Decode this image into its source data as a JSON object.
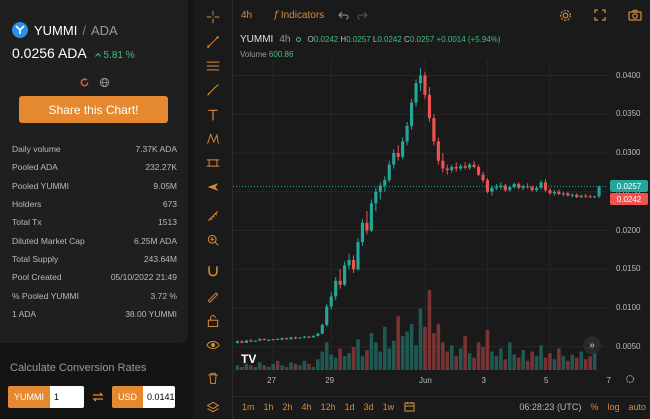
{
  "token": {
    "symbol": "YUMMI",
    "separator": "/",
    "quote": "ADA",
    "price": "0.0256 ADA",
    "change": "5.81 %",
    "change_arrow": "^"
  },
  "share_button_label": "Share this Chart!",
  "stats": [
    {
      "label": "Daily volume",
      "value": "7.37K ADA"
    },
    {
      "label": "Pooled ADA",
      "value": "232.27K"
    },
    {
      "label": "Pooled YUMMI",
      "value": "9.05M"
    },
    {
      "label": "Holders",
      "value": "673"
    },
    {
      "label": "Total Tx",
      "value": "1513"
    },
    {
      "label": "Diluted Market Cap",
      "value": "6.25M ADA"
    },
    {
      "label": "Total Supply",
      "value": "243.64M"
    },
    {
      "label": "Pool Created",
      "value": "05/10/2022 21:49"
    },
    {
      "label": "% Pooled YUMMI",
      "value": "3.72 %"
    },
    {
      "label": "1 ADA",
      "value": "38.00 YUMMI"
    }
  ],
  "conversion": {
    "title": "Calculate Conversion Rates",
    "from_label": "YUMMI",
    "from_value": "1",
    "to_label": "USD",
    "to_value": "0.0141"
  },
  "chart_toolbar": {
    "interval": "4h",
    "indicators_label": "Indicators"
  },
  "chart_legend": {
    "symbol": "YUMMI",
    "interval": "4h",
    "o_label": "O",
    "o": "0.0242",
    "h_label": "H",
    "h": "0.0257",
    "l_label": "L",
    "l": "0.0242",
    "c_label": "C",
    "c": "0.0257",
    "change": "+0.0014 (+5.94%)",
    "volume_label": "Volume",
    "volume": "600.86"
  },
  "bottom_bar": {
    "timeframes": [
      "1m",
      "1h",
      "2h",
      "4h",
      "12h",
      "1d",
      "3d",
      "1w"
    ],
    "clock": "06:28:23 (UTC)",
    "percent": "%",
    "log": "log",
    "auto": "auto"
  },
  "tv_logo": "TV",
  "colors": {
    "up": "#26a69a",
    "down": "#ef5350",
    "accent": "#e4892f"
  },
  "chart_data": {
    "type": "candlestick",
    "ylim": [
      0.002,
      0.042
    ],
    "yticks": [
      "0.0400",
      "0.0350",
      "0.0300",
      "0.0250",
      "0.0200",
      "0.0150",
      "0.0100",
      "0.0050"
    ],
    "ytick_values": [
      0.04,
      0.035,
      0.03,
      0.025,
      0.02,
      0.015,
      0.01,
      0.005
    ],
    "xticks": [
      "27",
      "29",
      "Jun",
      "3",
      "5",
      "7"
    ],
    "xtick_index": [
      8,
      21,
      42,
      56,
      70,
      84
    ],
    "last_price_tag": "0.0257",
    "low_price_tag": "0.0242",
    "last_price": 0.0257,
    "low_price": 0.0242,
    "candles": [
      [
        0.0055,
        0.0058,
        0.0054,
        0.0057
      ],
      [
        0.0057,
        0.0058,
        0.0055,
        0.0055
      ],
      [
        0.0055,
        0.0059,
        0.0055,
        0.0058
      ],
      [
        0.0058,
        0.006,
        0.0056,
        0.0057
      ],
      [
        0.0057,
        0.0058,
        0.0056,
        0.0058
      ],
      [
        0.0058,
        0.0061,
        0.0057,
        0.006
      ],
      [
        0.006,
        0.0061,
        0.0058,
        0.0059
      ],
      [
        0.0059,
        0.006,
        0.0057,
        0.0059
      ],
      [
        0.0059,
        0.006,
        0.0058,
        0.006
      ],
      [
        0.006,
        0.0061,
        0.0059,
        0.0059
      ],
      [
        0.0059,
        0.0062,
        0.0059,
        0.0061
      ],
      [
        0.0061,
        0.0062,
        0.0059,
        0.006
      ],
      [
        0.006,
        0.0063,
        0.0059,
        0.0062
      ],
      [
        0.0062,
        0.0063,
        0.006,
        0.0061
      ],
      [
        0.0061,
        0.0062,
        0.006,
        0.0062
      ],
      [
        0.0062,
        0.0064,
        0.0061,
        0.0063
      ],
      [
        0.0063,
        0.0064,
        0.0061,
        0.0062
      ],
      [
        0.0062,
        0.0065,
        0.0062,
        0.0064
      ],
      [
        0.0064,
        0.0068,
        0.0063,
        0.0067
      ],
      [
        0.0067,
        0.008,
        0.0066,
        0.0078
      ],
      [
        0.0078,
        0.0105,
        0.0076,
        0.0102
      ],
      [
        0.0102,
        0.012,
        0.0098,
        0.0115
      ],
      [
        0.0115,
        0.014,
        0.011,
        0.0135
      ],
      [
        0.0135,
        0.015,
        0.0125,
        0.013
      ],
      [
        0.013,
        0.016,
        0.0128,
        0.0155
      ],
      [
        0.0155,
        0.017,
        0.015,
        0.0162
      ],
      [
        0.0162,
        0.0168,
        0.0145,
        0.015
      ],
      [
        0.015,
        0.019,
        0.0148,
        0.0185
      ],
      [
        0.0185,
        0.0215,
        0.018,
        0.021
      ],
      [
        0.021,
        0.0225,
        0.0195,
        0.02
      ],
      [
        0.02,
        0.024,
        0.0198,
        0.0235
      ],
      [
        0.0235,
        0.0255,
        0.0225,
        0.025
      ],
      [
        0.025,
        0.0262,
        0.024,
        0.0258
      ],
      [
        0.0258,
        0.027,
        0.025,
        0.0265
      ],
      [
        0.0265,
        0.029,
        0.0262,
        0.0285
      ],
      [
        0.0285,
        0.0305,
        0.028,
        0.03
      ],
      [
        0.03,
        0.031,
        0.029,
        0.0295
      ],
      [
        0.0295,
        0.032,
        0.0292,
        0.0315
      ],
      [
        0.0315,
        0.034,
        0.031,
        0.0335
      ],
      [
        0.0335,
        0.037,
        0.033,
        0.0365
      ],
      [
        0.0365,
        0.0395,
        0.036,
        0.039
      ],
      [
        0.039,
        0.041,
        0.038,
        0.04
      ],
      [
        0.04,
        0.0405,
        0.037,
        0.0375
      ],
      [
        0.0375,
        0.0385,
        0.034,
        0.0345
      ],
      [
        0.0345,
        0.035,
        0.031,
        0.0315
      ],
      [
        0.0315,
        0.032,
        0.0285,
        0.029
      ],
      [
        0.029,
        0.03,
        0.0275,
        0.028
      ],
      [
        0.028,
        0.0285,
        0.0272,
        0.0278
      ],
      [
        0.0278,
        0.0285,
        0.0275,
        0.0282
      ],
      [
        0.0282,
        0.0288,
        0.0276,
        0.028
      ],
      [
        0.028,
        0.0286,
        0.0277,
        0.0283
      ],
      [
        0.0283,
        0.0288,
        0.0279,
        0.0281
      ],
      [
        0.0281,
        0.0287,
        0.0278,
        0.0285
      ],
      [
        0.0285,
        0.029,
        0.028,
        0.0282
      ],
      [
        0.0282,
        0.0285,
        0.027,
        0.0272
      ],
      [
        0.0272,
        0.0276,
        0.0262,
        0.0265
      ],
      [
        0.0265,
        0.0268,
        0.0248,
        0.025
      ],
      [
        0.025,
        0.0258,
        0.0245,
        0.0255
      ],
      [
        0.0255,
        0.026,
        0.0252,
        0.0256
      ],
      [
        0.0256,
        0.0262,
        0.0253,
        0.0258
      ],
      [
        0.0258,
        0.026,
        0.025,
        0.0252
      ],
      [
        0.0252,
        0.0258,
        0.025,
        0.0256
      ],
      [
        0.0256,
        0.0262,
        0.0254,
        0.026
      ],
      [
        0.026,
        0.0262,
        0.0253,
        0.0255
      ],
      [
        0.0255,
        0.0259,
        0.0252,
        0.0257
      ],
      [
        0.0257,
        0.0261,
        0.0254,
        0.0256
      ],
      [
        0.0256,
        0.0258,
        0.025,
        0.0252
      ],
      [
        0.0252,
        0.0257,
        0.025,
        0.0255
      ],
      [
        0.0255,
        0.0265,
        0.0253,
        0.0262
      ],
      [
        0.0262,
        0.0266,
        0.025,
        0.0252
      ],
      [
        0.0252,
        0.0255,
        0.0246,
        0.0248
      ],
      [
        0.0248,
        0.0252,
        0.0245,
        0.025
      ],
      [
        0.025,
        0.0253,
        0.0246,
        0.0247
      ],
      [
        0.0247,
        0.025,
        0.0244,
        0.0248
      ],
      [
        0.0248,
        0.025,
        0.0244,
        0.0245
      ],
      [
        0.0245,
        0.0248,
        0.0243,
        0.0246
      ],
      [
        0.0246,
        0.0248,
        0.0242,
        0.0243
      ],
      [
        0.0243,
        0.0246,
        0.0242,
        0.0245
      ],
      [
        0.0245,
        0.0247,
        0.0242,
        0.0244
      ],
      [
        0.0244,
        0.0246,
        0.0242,
        0.0243
      ],
      [
        0.0243,
        0.0245,
        0.0242,
        0.0244
      ],
      [
        0.0244,
        0.0257,
        0.0242,
        0.0257
      ]
    ],
    "volumes": [
      3,
      2,
      4,
      3,
      2,
      5,
      3,
      2,
      4,
      6,
      3,
      2,
      5,
      4,
      3,
      6,
      4,
      2,
      7,
      12,
      18,
      10,
      8,
      14,
      9,
      11,
      15,
      20,
      9,
      13,
      24,
      18,
      12,
      28,
      14,
      19,
      35,
      22,
      25,
      30,
      16,
      40,
      28,
      52,
      24,
      30,
      18,
      12,
      16,
      9,
      14,
      22,
      11,
      8,
      18,
      15,
      26,
      12,
      9,
      14,
      7,
      18,
      10,
      8,
      13,
      6,
      12,
      9,
      16,
      8,
      11,
      7,
      14,
      9,
      6,
      10,
      8,
      12,
      7,
      9,
      18
    ]
  }
}
